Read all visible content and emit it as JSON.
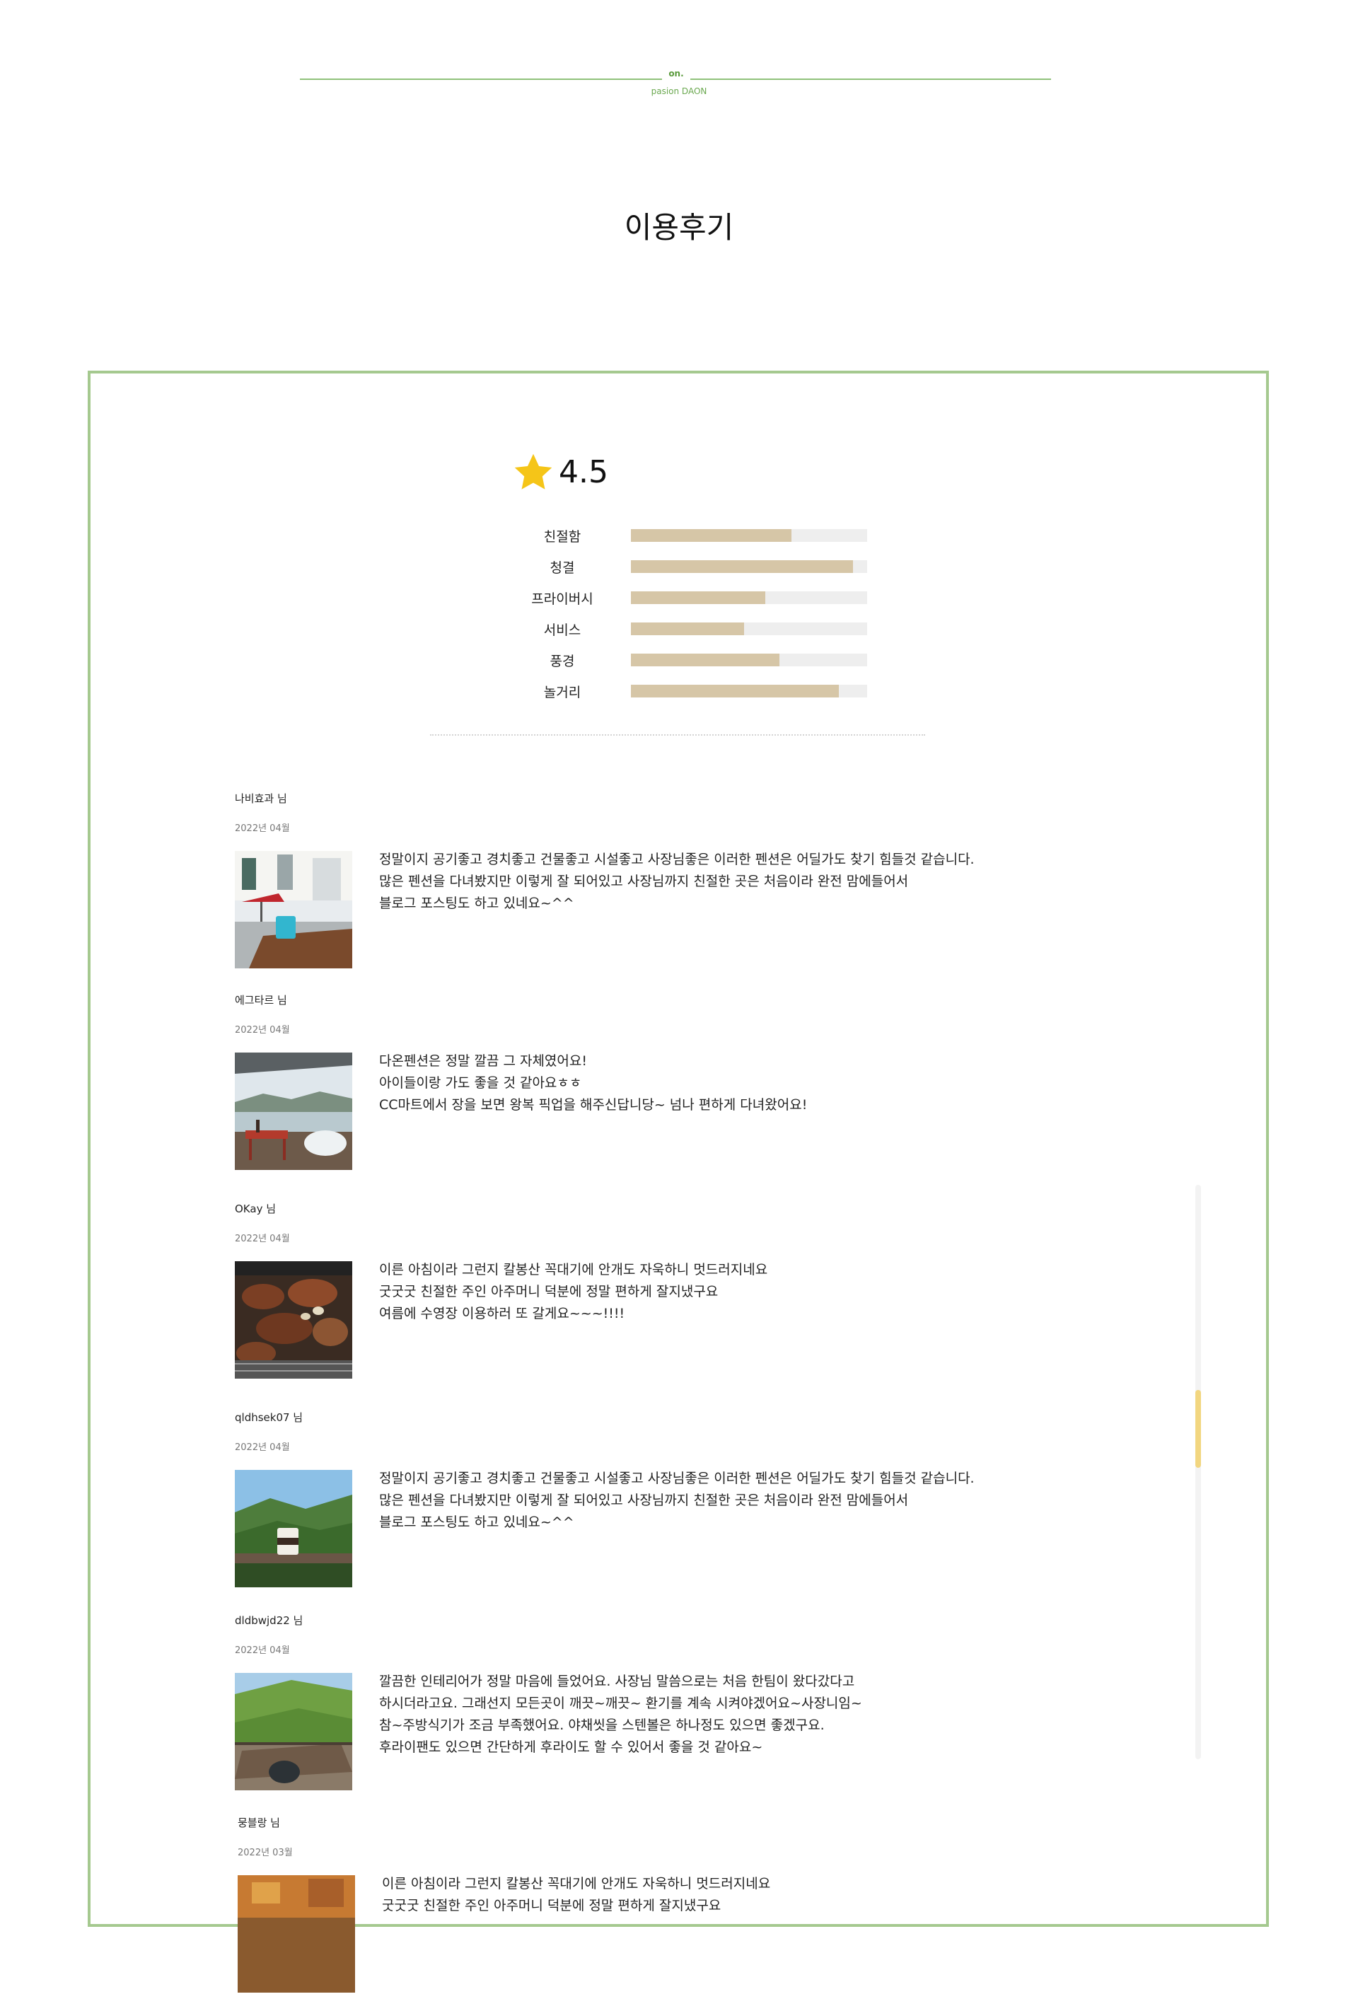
{
  "brand": {
    "mark": "on.",
    "sub": "pasion DAON"
  },
  "page_title": "이용후기",
  "summary": {
    "score": "4.5",
    "colors": {
      "fill": "#d6c6a7",
      "track": "#eeeeee",
      "star": "#f5c518",
      "border": "#a5c98f"
    },
    "metrics": [
      {
        "label": "친절함",
        "value": 0.68
      },
      {
        "label": "청결",
        "value": 0.94
      },
      {
        "label": "프라이버시",
        "value": 0.57
      },
      {
        "label": "서비스",
        "value": 0.48
      },
      {
        "label": "풍경",
        "value": 0.63
      },
      {
        "label": "놀거리",
        "value": 0.88
      }
    ]
  },
  "reviews": [
    {
      "author": "나비효과 님",
      "date": "2022년 04월",
      "photo": "terrace-table-icon",
      "text": "정말이지 공기좋고 경치좋고 건물좋고 시설좋고 사장님좋은 이러한 펜션은 어딜가도 찾기 힘들것 같습니다.\n많은 펜션을 다녀봤지만 이렇게 잘 되어있고 사장님까지 친절한 곳은 처음이라 완전 맘에들어서\n블로그 포스팅도 하고 있네요~^^"
    },
    {
      "author": "에그타르 님",
      "date": "2022년 04월",
      "photo": "lake-view-icon",
      "text": "다온펜션은 정말 깔끔 그 자체였어요!\n아이들이랑 가도 좋을 것 같아요ㅎㅎ\nCC마트에서 장을 보면 왕복 픽업을 해주신답니당~ 넘나 편하게 다녀왔어요!"
    },
    {
      "author": "OKay 님",
      "date": "2022년 04월",
      "photo": "bbq-grill-icon",
      "text": "이른 아침이라 그런지 칼봉산 꼭대기에 안개도 자욱하니 멋드러지네요\n굿굿굿 친절한 주인 아주머니 덕분에 정말 편하게 잘지냈구요\n여름에 수영장 이용하러 또 갈게요~~~!!!!"
    },
    {
      "author": "qldhsek07 님",
      "date": "2022년 04월",
      "photo": "mountain-coffee-icon",
      "text": "정말이지 공기좋고 경치좋고 건물좋고 시설좋고 사장님좋은 이러한 펜션은 어딜가도 찾기 힘들것 같습니다.\n많은 펜션을 다녀봤지만 이렇게 잘 되어있고 사장님까지 친절한 곳은 처음이라 완전 맘에들어서\n블로그 포스팅도 하고 있네요~^^"
    },
    {
      "author": "dldbwjd22 님",
      "date": "2022년 04월",
      "photo": "forest-deck-icon",
      "text": "깔끔한 인테리어가 정말 마음에 들었어요. 사장님 말씀으로는 처음 한팀이 왔다갔다고\n하시더라고요.  그래선지 모든곳이 깨끗~깨끗~ 환기를 계속 시켜야겠어요~사장니임~\n참~주방식기가 조금 부족했어요. 야채씻을 스텐볼은 하나정도 있으면 좋겠구요.\n후라이팬도 있으면 간단하게 후라이도 할 수 있어서 좋을 것 같아요~"
    },
    {
      "author": "뭉블랑 님",
      "date": "2022년 03월",
      "photo": "autumn-stream-icon",
      "text": "이른 아침이라 그런지 칼봉산 꼭대기에 안개도 자욱하니 멋드러지네요\n굿굿굿 친절한 주인 아주머니 덕분에 정말 편하게 잘지냈구요"
    }
  ]
}
